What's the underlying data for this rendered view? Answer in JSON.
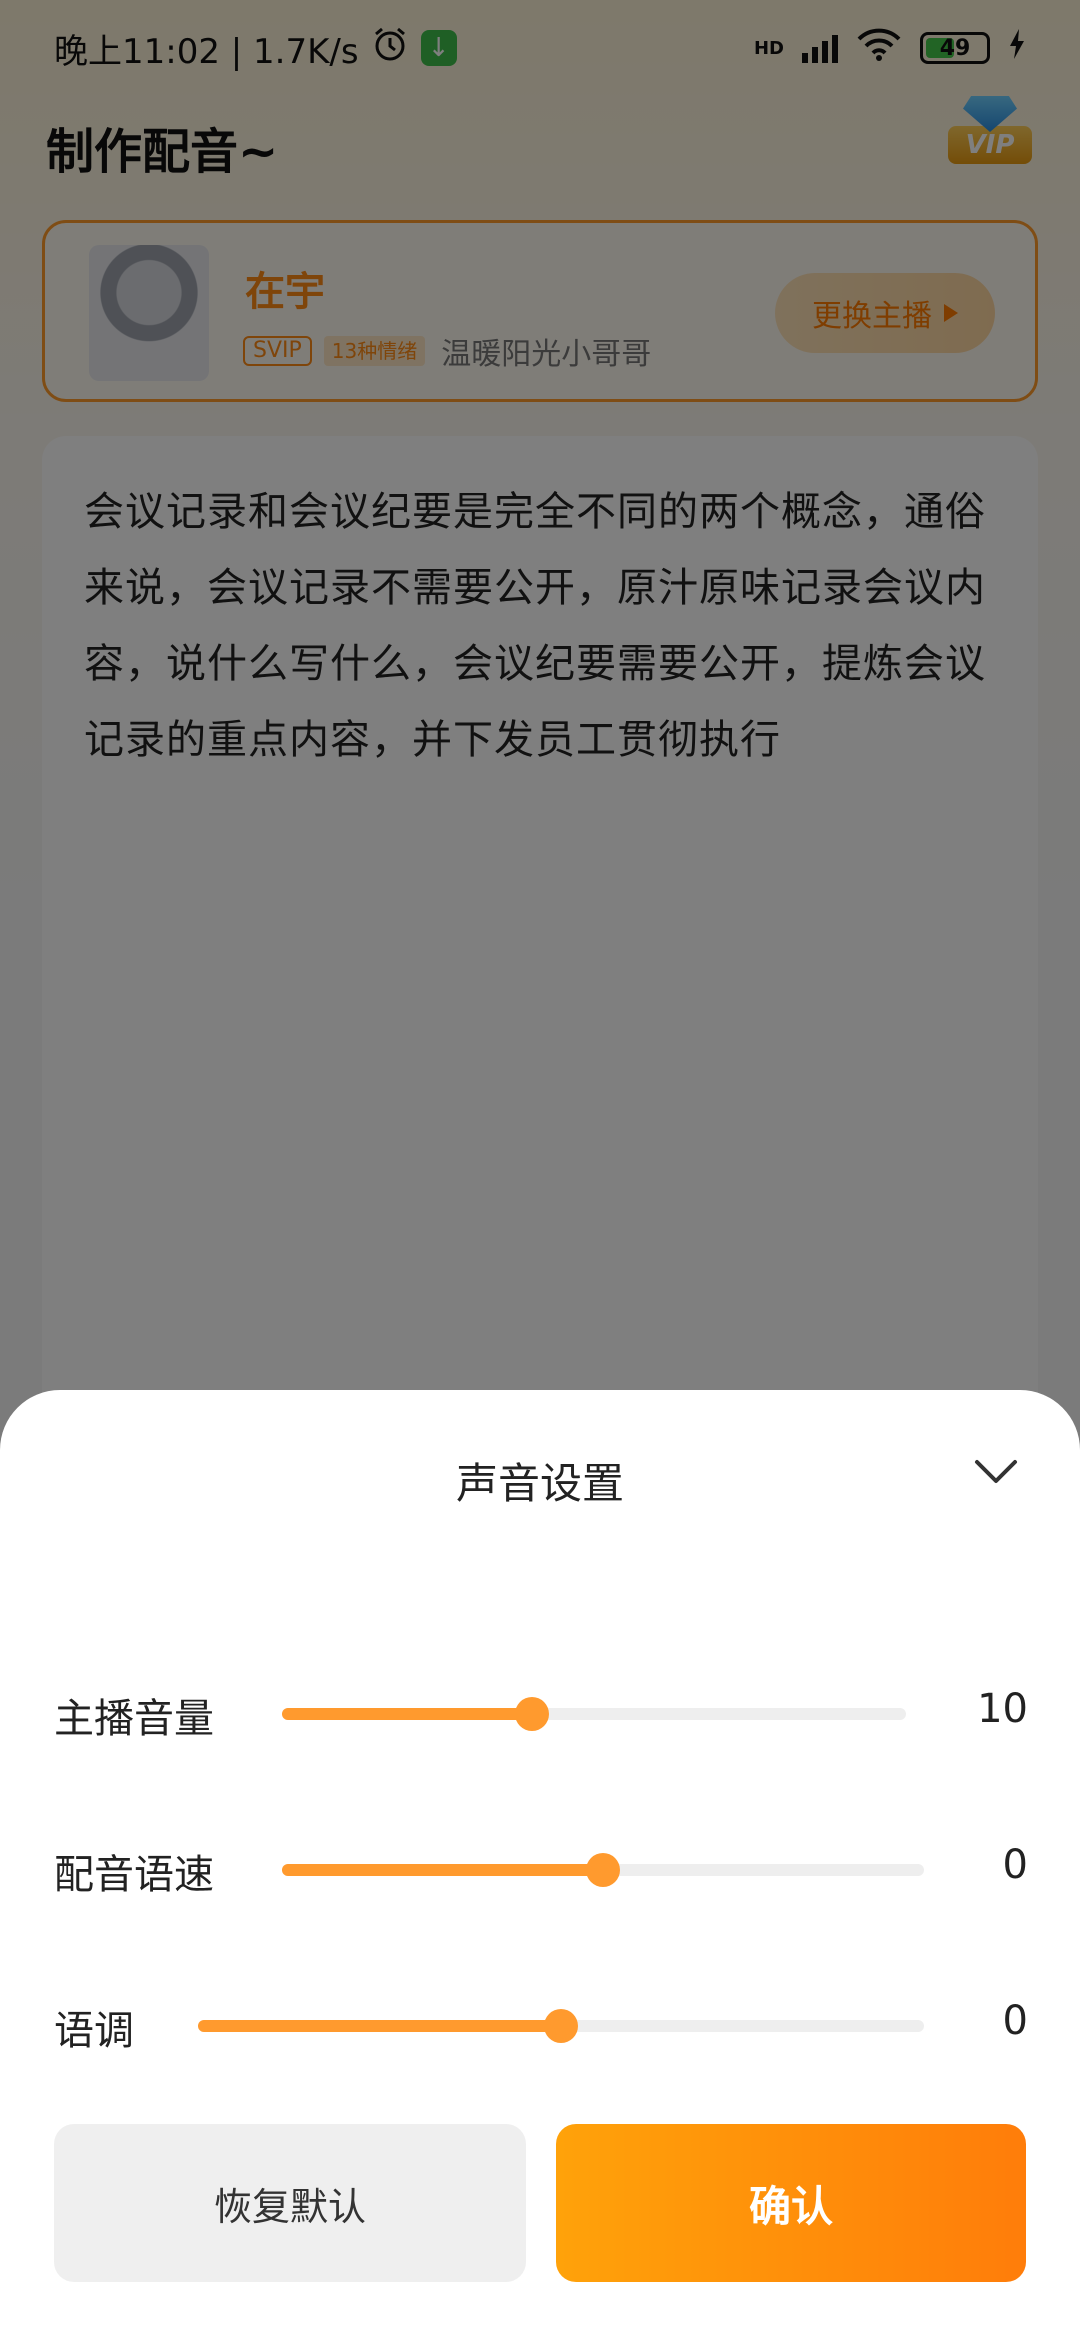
{
  "status_bar": {
    "time_label": "晚上11:02 | 1.7K/s",
    "battery": "49",
    "network": "HD"
  },
  "header": {
    "title": "制作配音~",
    "vip_label": "VIP"
  },
  "anchor": {
    "name": "在宇",
    "svip_tag": "SVIP",
    "emotions_tag": "13种情绪",
    "description": "温暖阳光小哥哥",
    "change_button": "更换主播"
  },
  "editor": {
    "text": "会议记录和会议纪要是完全不同的两个概念，通俗来说，会议记录不需要公开，原汁原味记录会议内容，说什么写什么，会议纪要需要公开，提炼会议记录的重点内容，并下发员工贯彻执行"
  },
  "sheet": {
    "title": "声音设置",
    "sliders": [
      {
        "label": "主播音量",
        "value": "10",
        "fraction": 0.4
      },
      {
        "label": "配音语速",
        "value": "0",
        "fraction": 0.5
      },
      {
        "label": "语调",
        "value": "0",
        "fraction": 0.5
      }
    ],
    "reset_button": "恢复默认",
    "confirm_button": "确认"
  },
  "colors": {
    "accent": "#ff9a2e",
    "confirm_start": "#ffa20a",
    "confirm_end": "#ff7d0a"
  }
}
